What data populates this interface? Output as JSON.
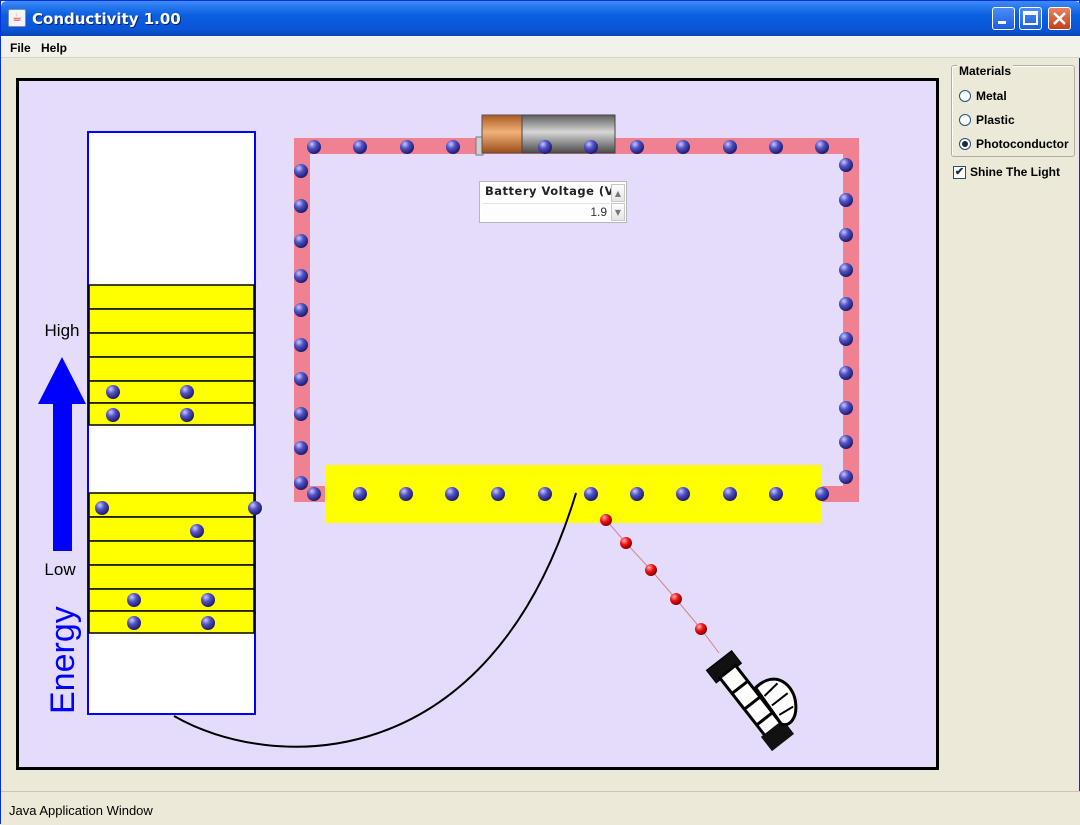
{
  "window": {
    "title": "Conductivity 1.00",
    "icon": "java-cup-icon"
  },
  "menu": {
    "file": "File",
    "help": "Help"
  },
  "energy_diagram": {
    "axis_title": "Energy",
    "high_label": "High",
    "low_label": "Low"
  },
  "battery": {
    "voltage_label": "Battery Voltage (V)",
    "voltage_value": "1.9"
  },
  "materials": {
    "title": "Materials",
    "options": [
      "Metal",
      "Plastic",
      "Photoconductor"
    ],
    "selected": "Photoconductor"
  },
  "shine_light": {
    "label": "Shine The Light",
    "checked": true
  },
  "status": {
    "text": "Java Application Window"
  },
  "colors": {
    "stage_bg": "#e4dcfa",
    "wire": "#ef8193",
    "band": "#ffff00",
    "arrow": "#0000ff",
    "electron": "#3f3fb0",
    "photon": "#ee1111"
  }
}
